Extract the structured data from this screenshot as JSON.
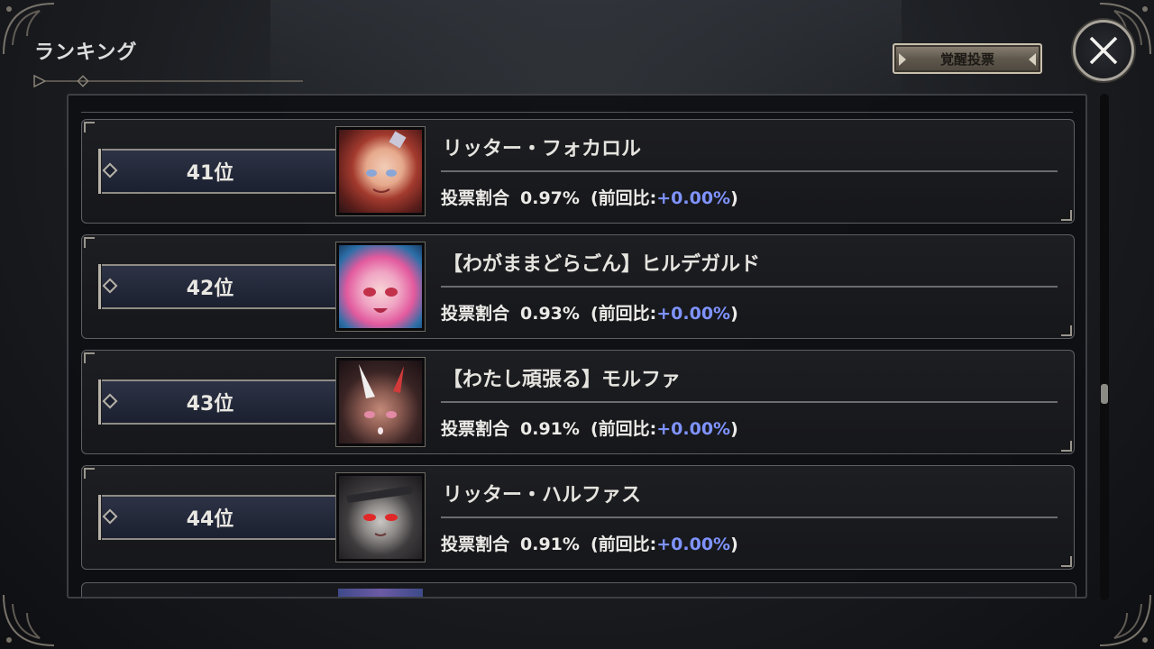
{
  "header": {
    "title": "ランキング",
    "vote_button": "覚醒投票",
    "close_icon": "close-x-icon"
  },
  "colors": {
    "delta_text": "#7f93ff",
    "rank_plate": "#2d3345",
    "vote_button": "#6b6357"
  },
  "rankings": [
    {
      "rank": "41位",
      "name": "リッター・フォカロル",
      "label": "投票割合",
      "percent": "0.97%",
      "prev_open": "(前回比:",
      "delta": "+0.00%",
      "prev_close": ")"
    },
    {
      "rank": "42位",
      "name": "【わがままどらごん】ヒルデガルド",
      "label": "投票割合",
      "percent": "0.93%",
      "prev_open": "(前回比:",
      "delta": "+0.00%",
      "prev_close": ")"
    },
    {
      "rank": "43位",
      "name": "【わたし頑張る】モルファ",
      "label": "投票割合",
      "percent": "0.91%",
      "prev_open": "(前回比:",
      "delta": "+0.00%",
      "prev_close": ")"
    },
    {
      "rank": "44位",
      "name": "リッター・ハルファス",
      "label": "投票割合",
      "percent": "0.91%",
      "prev_open": "(前回比:",
      "delta": "+0.00%",
      "prev_close": ")"
    }
  ]
}
